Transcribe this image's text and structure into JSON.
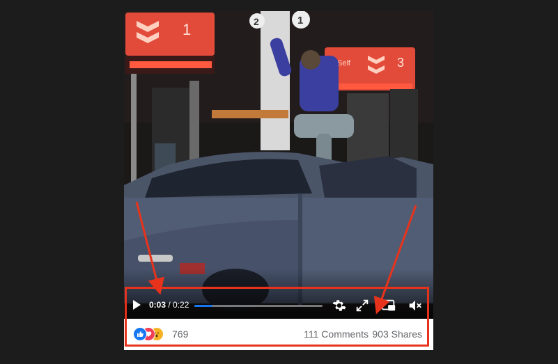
{
  "player": {
    "current_time": "0:03",
    "separator": " / ",
    "duration": "0:22",
    "progress": 0.14,
    "accent_color": "#1877f2",
    "scene_text": {
      "pump_1_number": "1",
      "pump_3_number": "3",
      "pump_3_label": "Self",
      "pole_number_2": "2",
      "pole_number_1": "1"
    },
    "icons": {
      "play": "play-icon",
      "settings": "gear-icon",
      "fullscreen": "expand-icon",
      "pip": "picture-in-picture-icon",
      "mute": "speaker-muted-icon"
    }
  },
  "engagement": {
    "reaction_icons": [
      "like-icon",
      "love-icon",
      "wow-icon"
    ],
    "reaction_count": "769",
    "comments": "111 Comments",
    "shares": "903 Shares"
  },
  "annotation": {
    "color": "#e8331c"
  }
}
